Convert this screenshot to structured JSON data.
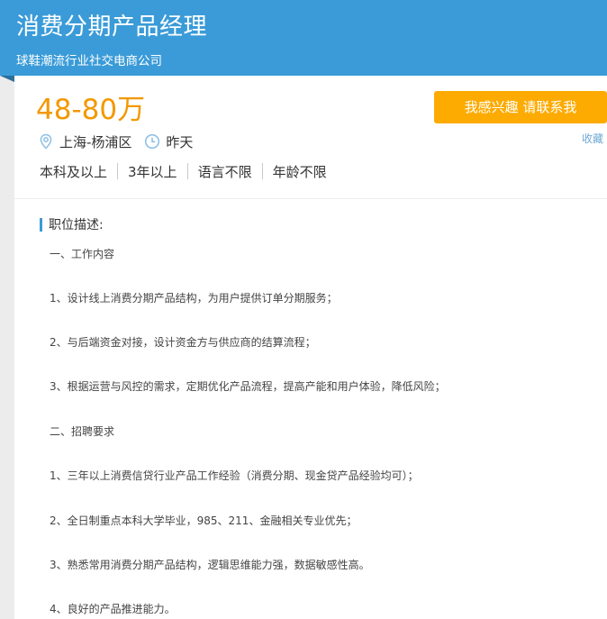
{
  "job": {
    "title": "消费分期产品经理",
    "company": "球鞋潮流行业社交电商公司",
    "salary": "48-80万",
    "location": "上海-杨浦区",
    "posted": "昨天",
    "requirements": [
      "本科及以上",
      "3年以上",
      "语言不限",
      "年龄不限"
    ]
  },
  "actions": {
    "apply_label": "我感兴趣 请联系我",
    "favorite_label": "收藏"
  },
  "description": {
    "heading": "职位描述:",
    "lines": [
      "一、工作内容",
      "1、设计线上消费分期产品结构，为用户提供订单分期服务；",
      "2、与后端资金对接，设计资金方与供应商的结算流程；",
      "3、根据运营与风控的需求，定期优化产品流程，提高产能和用户体验，降低风险；",
      "二、招聘要求",
      "1、三年以上消费信贷行业产品工作经验（消费分期、现金贷产品经验均可）；",
      "2、全日制重点本科大学毕业，985、211、金融相关专业优先；",
      "3、熟悉常用消费分期产品结构，逻辑思维能力强，数据敏感性高。",
      "4、良好的产品推进能力。"
    ]
  },
  "icons": {
    "location": "location-pin-icon",
    "time": "clock-icon"
  },
  "colors": {
    "header": "#3a9bd8",
    "salary": "#f39800",
    "button": "#fdab00",
    "link": "#6fa8d4"
  }
}
